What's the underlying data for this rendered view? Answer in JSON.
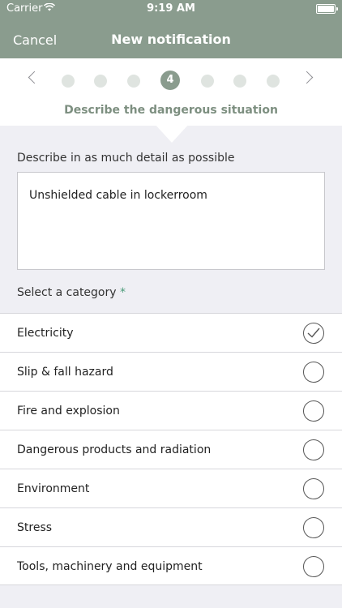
{
  "status": {
    "carrier": "Carrier",
    "time": "9:19 AM"
  },
  "nav": {
    "cancel": "Cancel",
    "title": "New notification"
  },
  "stepper": {
    "current": "4",
    "label": "Describe the dangerous situation"
  },
  "form": {
    "description_label": "Describe in as much detail as possible",
    "description_value": "Unshielded cable in lockerroom",
    "category_label": "Select a category",
    "required_mark": "*"
  },
  "categories": [
    {
      "label": "Electricity",
      "selected": true
    },
    {
      "label": "Slip & fall hazard",
      "selected": false
    },
    {
      "label": "Fire and explosion",
      "selected": false
    },
    {
      "label": "Dangerous products and radiation",
      "selected": false
    },
    {
      "label": "Environment",
      "selected": false
    },
    {
      "label": "Stress",
      "selected": false
    },
    {
      "label": "Tools, machinery and equipment",
      "selected": false
    }
  ],
  "colors": {
    "accent": "#8a9c8e",
    "required": "#4a9a78"
  }
}
